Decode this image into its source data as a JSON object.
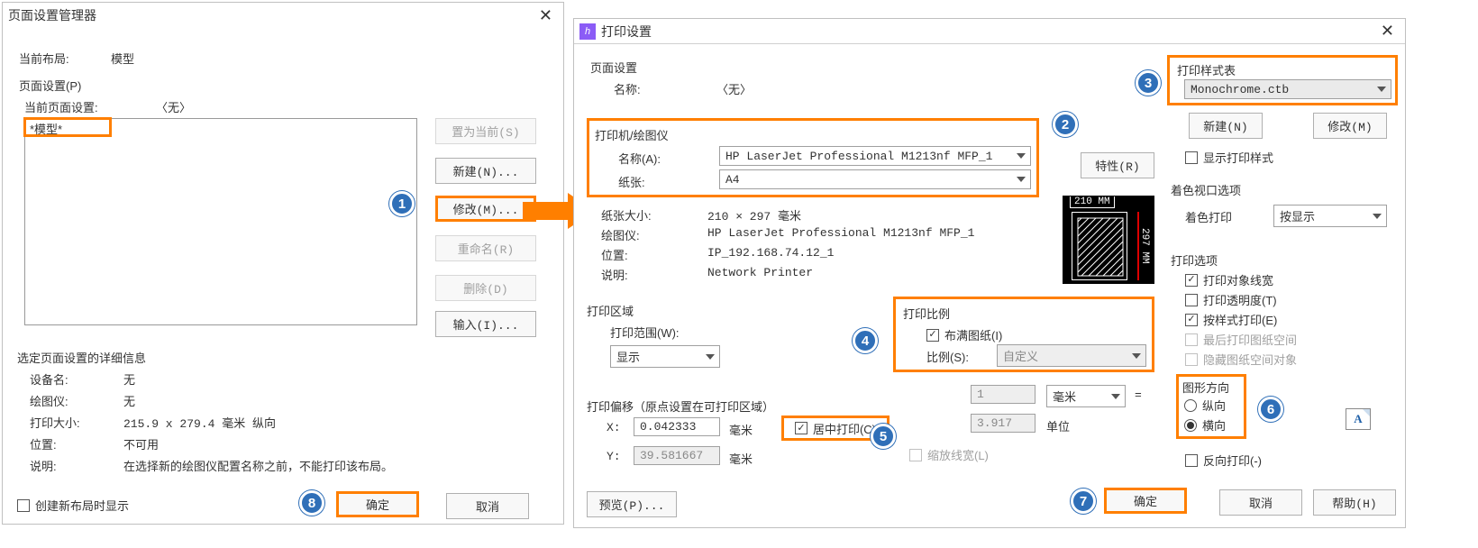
{
  "left": {
    "title": "页面设置管理器",
    "current_layout_label": "当前布局:",
    "current_layout_value": "模型",
    "group1_title": "页面设置(P)",
    "current_page_label": "当前页面设置:",
    "current_page_value": "〈无〉",
    "list_item": "*模型*",
    "btn_set_current": "置为当前(S)",
    "btn_new": "新建(N)...",
    "btn_modify": "修改(M)...",
    "btn_rename": "重命名(R)",
    "btn_delete": "删除(D)",
    "btn_import": "输入(I)...",
    "group2_title": "选定页面设置的详细信息",
    "dev_label": "设备名:",
    "dev_val": "无",
    "plot_label": "绘图仪:",
    "plot_val": "无",
    "paper_label": "打印大小:",
    "paper_val": "215.9 x 279.4 毫米 纵向",
    "loc_label": "位置:",
    "loc_val": "不可用",
    "desc_label": "说明:",
    "desc_val": "在选择新的绘图仪配置名称之前，不能打印该布局。",
    "chk_create": "创建新布局时显示",
    "btn_ok": "确定",
    "btn_cancel": "取消"
  },
  "right": {
    "title": "打印设置",
    "g_page": "页面设置",
    "name_label": "名称:",
    "name_val": "〈无〉",
    "g_printer": "打印机/绘图仪",
    "p_name_label": "名称(A):",
    "p_name_val": "HP LaserJet Professional M1213nf MFP_1",
    "p_paper_label": "纸张:",
    "p_paper_val": "A4",
    "paper_size_label": "纸张大小:",
    "paper_size_val": "210 × 297 毫米",
    "plotter_label": "绘图仪:",
    "plotter_val": "HP LaserJet Professional M1213nf MFP_1",
    "loc2_label": "位置:",
    "loc2_val": "IP_192.168.74.12_1",
    "desc2_label": "说明:",
    "desc2_val": "Network Printer",
    "btn_props": "特性(R)",
    "g_area": "打印区域",
    "range_label": "打印范围(W):",
    "range_val": "显示",
    "g_offset": "打印偏移（原点设置在可打印区域）",
    "x_label": "X:",
    "x_val": "0.042333",
    "x_unit": "毫米",
    "y_label": "Y:",
    "y_val": "39.581667",
    "y_unit": "毫米",
    "chk_center": "居中打印(C)",
    "g_scale": "打印比例",
    "chk_fit": "布满图纸(I)",
    "scale_label": "比例(S):",
    "scale_val": "自定义",
    "scale_num": "1",
    "scale_unit_val": "毫米",
    "scale_eq": "=",
    "scale_den": "3.917",
    "scale_unit2": "单位",
    "chk_lineweight": "缩放线宽(L)",
    "g_style": "打印样式表",
    "style_val": "Monochrome.ctb",
    "btn_style_new": "新建(N)",
    "btn_style_mod": "修改(M)",
    "chk_show_style": "显示打印样式",
    "g_shade": "着色视口选项",
    "shade_label": "着色打印",
    "shade_val": "按显示",
    "g_opts": "打印选项",
    "opt1": "打印对象线宽",
    "opt2": "打印透明度(T)",
    "opt3": "按样式打印(E)",
    "opt4": "最后打印图纸空间",
    "opt5": "隐藏图纸空间对象",
    "g_orient": "图形方向",
    "orient_p": "纵向",
    "orient_l": "横向",
    "chk_reverse": "反向打印(-)",
    "btn_preview": "预览(P)...",
    "btn_ok2": "确定",
    "btn_cancel2": "取消",
    "btn_help": "帮助(H)",
    "preview_w": "210 MM",
    "preview_h": "297 MM"
  },
  "badges": {
    "b1": "1",
    "b2": "2",
    "b3": "3",
    "b4": "4",
    "b5": "5",
    "b6": "6",
    "b7": "7",
    "b8": "8"
  }
}
